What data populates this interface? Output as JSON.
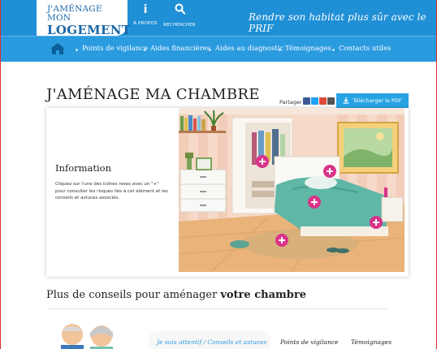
{
  "header": {
    "logo_top": "J'AMÉNAGE MON",
    "logo_bottom": "LOGEMENT",
    "apropos_label": "À PROPOS",
    "search_label": "RECHERCHER",
    "tagline": "Rendre son habitat plus sûr avec le PRIF",
    "colors": {
      "header": "#1f8fd6",
      "nav": "#2b9be0",
      "logo_text": "#1a67a8"
    }
  },
  "nav": {
    "items": [
      {
        "label": "Points de vigilance"
      },
      {
        "label": "Aides financières"
      },
      {
        "label": "Aides au diagnostic"
      },
      {
        "label": "Témoignages"
      },
      {
        "label": "Contacts utiles"
      }
    ]
  },
  "page": {
    "title": "J'AMÉNAGE MA CHAMBRE",
    "share_label": "Partager",
    "share_icons": [
      "facebook-icon",
      "twitter-icon",
      "google-plus-icon",
      "email-icon"
    ],
    "pdf_button": "Télécharger le PDF"
  },
  "info": {
    "title": "Information",
    "text": "Cliquez sur l'une des icônes roses avec un \"+\" pour consulter les risques liés à cet élément et les conseils et astuces associés."
  },
  "hotspot_color": "#d9338a",
  "section": {
    "title_normal": "Plus de conseils pour aménager ",
    "title_bold": "votre chambre"
  },
  "tabs": [
    {
      "label": "Je suis attentif / Conseils et astuces"
    },
    {
      "label": "Points de vigilance"
    },
    {
      "label": "Témoignages"
    }
  ]
}
